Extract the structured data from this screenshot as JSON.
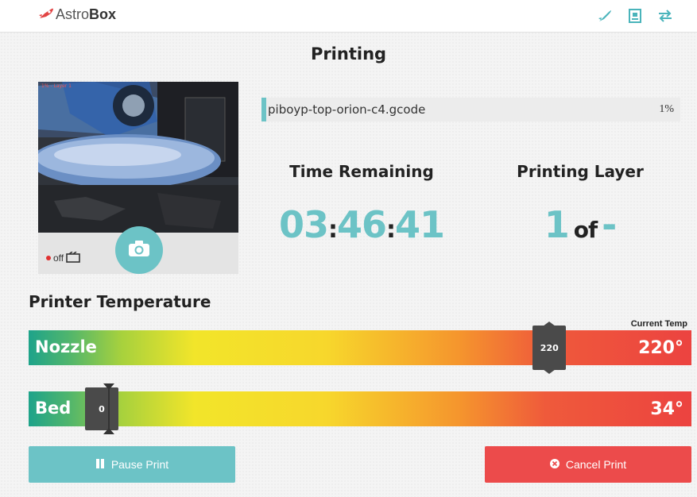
{
  "header": {
    "logo": {
      "text_light": "Astro",
      "text_bold": "Box"
    },
    "icons": [
      "rocket-icon",
      "control-icon",
      "connection-icon"
    ]
  },
  "page": {
    "title": "Printing"
  },
  "camera": {
    "caption": "1% - Layer 1",
    "timelapse_label": "off",
    "snapshot_icon": "camera-icon"
  },
  "progress": {
    "filename": "piboyp-top-orion-c4.gcode",
    "percent_text": "1%",
    "percent_value": 1
  },
  "time_remaining": {
    "label": "Time Remaining",
    "hours": "03",
    "minutes": "46",
    "seconds": "41",
    "separator": ":"
  },
  "printing_layer": {
    "label": "Printing Layer",
    "current": "1",
    "of_text": "of",
    "total": "-"
  },
  "temperature": {
    "title": "Printer Temperature",
    "current_label": "Current Temp",
    "max_temp": 280,
    "nozzle": {
      "name": "Nozzle",
      "target": "220",
      "current": "220°",
      "current_value": 220,
      "target_value": 220
    },
    "bed": {
      "name": "Bed",
      "target": "0",
      "current": "34°",
      "current_value": 34,
      "target_value": 0
    }
  },
  "actions": {
    "pause_label": "Pause Print",
    "cancel_label": "Cancel Print"
  },
  "colors": {
    "accent": "#6cc3c6",
    "danger": "#ec4b4b",
    "dark": "#222222"
  }
}
